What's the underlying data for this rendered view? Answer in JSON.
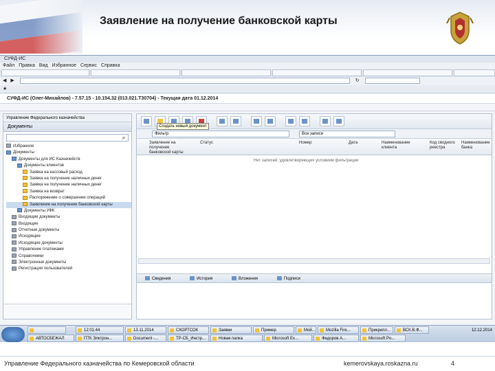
{
  "slide": {
    "title": "Заявление на получение банковской карты",
    "footer_org": "Управление Федерального казначейства по Кемеровской области",
    "footer_site": "kemerovskaya.roskazna.ru",
    "page_number": "4"
  },
  "app": {
    "title_bar": "СУФД-ИС (Олег-Михайлов) - 7.57.15 - 10.154.32 (013.021.T30704) - Текущая дата 01.12.2014",
    "left_panel_header": "Управление Федерального казначейства",
    "left_tab": "Документы",
    "tree": [
      {
        "label": "Избранное",
        "level": 0
      },
      {
        "label": "Документы",
        "level": 0
      },
      {
        "label": "Документы для ИС Казначейств",
        "level": 1
      },
      {
        "label": "Документы клиентов",
        "level": 2
      },
      {
        "label": "Заявка на кассовый расход",
        "level": 3
      },
      {
        "label": "Заявка на получение наличных денег",
        "level": 3
      },
      {
        "label": "Заявка на получение наличных денег",
        "level": 3
      },
      {
        "label": "Заявка на возврат",
        "level": 3
      },
      {
        "label": "Распоряжение о совершении операций",
        "level": 3
      },
      {
        "label": "Заявление на получение банковской карты",
        "level": 3,
        "selected": true
      },
      {
        "label": "Документы УФК",
        "level": 2
      },
      {
        "label": "Входящие документы",
        "level": 1
      },
      {
        "label": "Входящие",
        "level": 1
      },
      {
        "label": "Отчетные документы",
        "level": 1
      },
      {
        "label": "Исходящие",
        "level": 1
      },
      {
        "label": "Исходящие документы",
        "level": 1
      },
      {
        "label": "Управление платежами",
        "level": 1
      },
      {
        "label": "Справочники",
        "level": 1
      },
      {
        "label": "Электронные документы",
        "level": 1
      },
      {
        "label": "Регистрация пользователей",
        "level": 1
      }
    ],
    "tooltip": "Создать новый документ",
    "filter_value": "Фильтр",
    "filter_scope": "Все записи",
    "columns": [
      "Заявление на получение банковской карты",
      "Статус",
      "Номер",
      "Дата",
      "Наименование клиента",
      "Код сводного реестра",
      "Наименование банка"
    ],
    "empty_message": "Нет записей, удовлетворяющих условиям фильтрации",
    "bottom_tabs": [
      "Сведения",
      "История",
      "Вложения",
      "Подписи"
    ]
  },
  "taskbar": {
    "items_top": [
      "",
      "12:01:44",
      "13.11.2014",
      "СКОРТСОК",
      "Заявки",
      "Пример",
      "Мой...",
      "Mozilla Fire...",
      "Прикрепл...",
      "ВСК.В.Ф..."
    ],
    "items_bottom": [
      "АВТОСБЕЖАЛ",
      "ПТК Элктрон...",
      "Document -...",
      "ТР-СБ_Инстр...",
      "Новая папка",
      "Microsoft Ex...",
      "Федоров А...",
      "Microsoft Po..."
    ],
    "tray": "12.12.2014"
  }
}
